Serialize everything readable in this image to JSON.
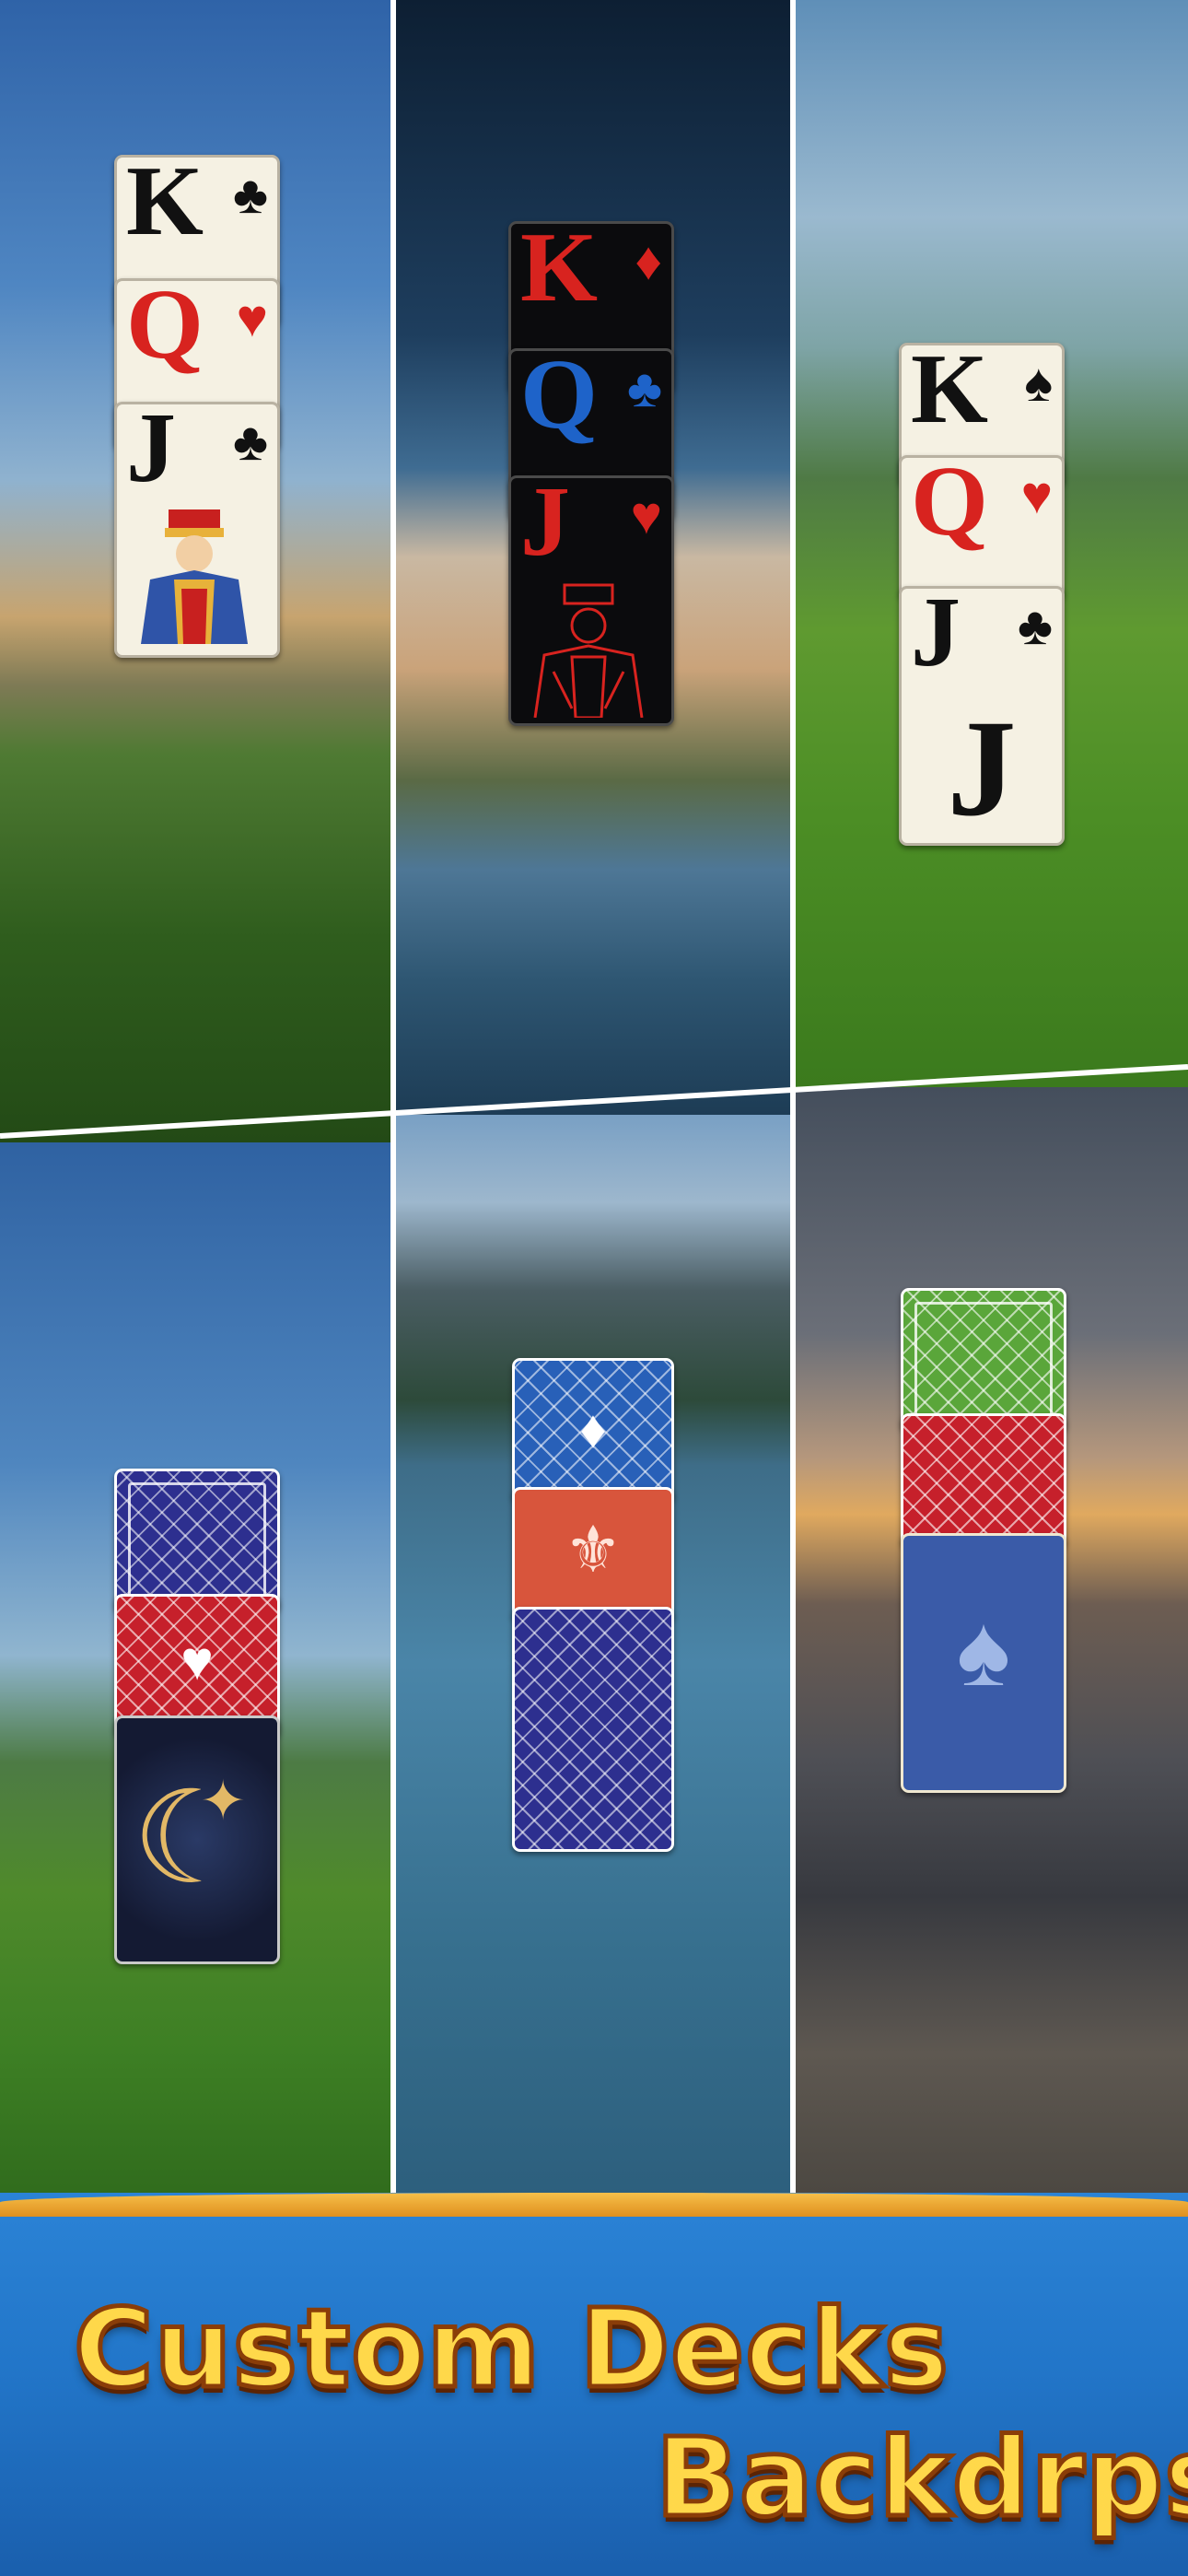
{
  "headline": {
    "line1": "Custom Decks",
    "line2": "Backdrps"
  },
  "top_decks": [
    {
      "style": "classic",
      "cards": [
        {
          "rank": "K",
          "suit": "♣"
        },
        {
          "rank": "Q",
          "suit": "♥"
        },
        {
          "rank": "J",
          "suit": "♣"
        }
      ]
    },
    {
      "style": "dark",
      "cards": [
        {
          "rank": "K",
          "suit": "♦"
        },
        {
          "rank": "Q",
          "suit": "♣"
        },
        {
          "rank": "J",
          "suit": "♥"
        }
      ]
    },
    {
      "style": "simple",
      "cards": [
        {
          "rank": "K",
          "suit": "♠"
        },
        {
          "rank": "Q",
          "suit": "♥"
        },
        {
          "rank": "J",
          "suit": "♣"
        }
      ],
      "center_rank": "J"
    }
  ],
  "card_backs": {
    "left": [
      "navy-diamond",
      "red-heart",
      "night-moon"
    ],
    "middle": [
      "blue-lattice",
      "coral-fleur",
      "navy-lattice"
    ],
    "right": [
      "green-lattice",
      "red-lattice",
      "royal-damask"
    ]
  },
  "icons": {
    "moon": "☾",
    "star": "✦",
    "diamond": "♦",
    "heart": "♥",
    "fleur": "⚜",
    "spade": "♠"
  },
  "colors": {
    "banner": "#2276c9",
    "title_fill": "#ffd84a",
    "title_stroke": "#8a3d08",
    "rim": "#f6c04a"
  }
}
